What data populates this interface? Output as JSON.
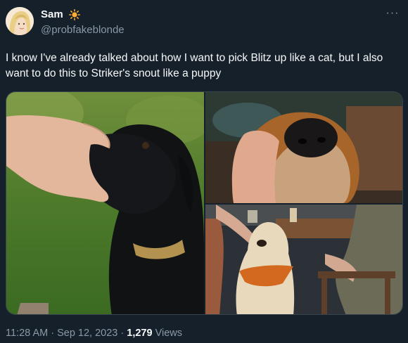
{
  "author": {
    "display_name": "Sam",
    "handle": "@probfakeblonde",
    "emoji_icon": "sun-icon",
    "avatar_icon": "avatar-illustration"
  },
  "menu": {
    "icon": "more-options-icon",
    "label": "···"
  },
  "tweet": {
    "text": "I know I've already talked about how I want to pick Blitz up like a cat, but I also want to do this to Striker's snout like a puppy"
  },
  "media": {
    "photos": [
      {
        "subject": "black dog with hand holding snout on grass"
      },
      {
        "subject": "close-up of brown dog nose held by hand"
      },
      {
        "subject": "golden retriever with orange bandana at restaurant table"
      }
    ]
  },
  "footer": {
    "time": "11:28 AM",
    "sep1": " · ",
    "date": "Sep 12, 2023",
    "sep2": " · ",
    "views_count": "1,279",
    "views_label": " Views"
  },
  "colors": {
    "background": "#15202b",
    "text_primary": "#f7f9f9",
    "text_secondary": "#8b98a5",
    "sun": "#ffac33"
  }
}
